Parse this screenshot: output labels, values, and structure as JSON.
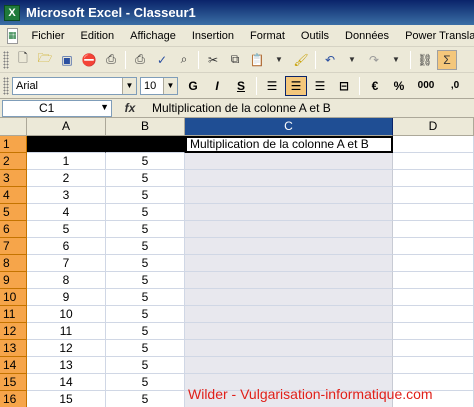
{
  "window": {
    "title": "Microsoft Excel - Classeur1"
  },
  "menu": {
    "items": [
      {
        "label": "Fichier"
      },
      {
        "label": "Edition"
      },
      {
        "label": "Affichage"
      },
      {
        "label": "Insertion"
      },
      {
        "label": "Format"
      },
      {
        "label": "Outils"
      },
      {
        "label": "Données"
      },
      {
        "label": "Power Translat"
      }
    ]
  },
  "toolbar": {
    "icons": [
      "new-icon",
      "open-icon",
      "save-icon",
      "permission-icon",
      "print-preview-icon",
      "print-icon",
      "spelling-icon",
      "research-icon",
      "cut-icon",
      "copy-icon",
      "paste-icon",
      "format-painter-icon",
      "undo-icon",
      "redo-icon",
      "link-icon",
      "sigma-icon"
    ]
  },
  "formatting": {
    "font": "Arial",
    "size": "10",
    "bold": "G",
    "italic": "I",
    "underline": "S",
    "currency": "€",
    "percent": "%",
    "thousands": "000",
    "decimal": ",0"
  },
  "formula_bar": {
    "name_box": "C1",
    "fx": "fx",
    "content": "Multiplication de la colonne A et B"
  },
  "grid": {
    "columns": [
      "A",
      "B",
      "C",
      "D"
    ],
    "selected_column": "C",
    "rows": [
      {
        "n": "1",
        "a": "",
        "b": "",
        "c": "Multiplication de la colonne A et B"
      },
      {
        "n": "2",
        "a": "1",
        "b": "5",
        "c": ""
      },
      {
        "n": "3",
        "a": "2",
        "b": "5",
        "c": ""
      },
      {
        "n": "4",
        "a": "3",
        "b": "5",
        "c": ""
      },
      {
        "n": "5",
        "a": "4",
        "b": "5",
        "c": ""
      },
      {
        "n": "6",
        "a": "5",
        "b": "5",
        "c": ""
      },
      {
        "n": "7",
        "a": "6",
        "b": "5",
        "c": ""
      },
      {
        "n": "8",
        "a": "7",
        "b": "5",
        "c": ""
      },
      {
        "n": "9",
        "a": "8",
        "b": "5",
        "c": ""
      },
      {
        "n": "10",
        "a": "9",
        "b": "5",
        "c": ""
      },
      {
        "n": "11",
        "a": "10",
        "b": "5",
        "c": ""
      },
      {
        "n": "12",
        "a": "11",
        "b": "5",
        "c": ""
      },
      {
        "n": "13",
        "a": "12",
        "b": "5",
        "c": ""
      },
      {
        "n": "14",
        "a": "13",
        "b": "5",
        "c": ""
      },
      {
        "n": "15",
        "a": "14",
        "b": "5",
        "c": ""
      },
      {
        "n": "16",
        "a": "15",
        "b": "5",
        "c": ""
      }
    ]
  },
  "watermark": "Wilder - Vulgarisation-informatique.com",
  "colors": {
    "title_bar": "#0a246a",
    "selected_header": "#1f4e94",
    "row_header": "#f6a54a",
    "watermark": "#e0201a"
  }
}
